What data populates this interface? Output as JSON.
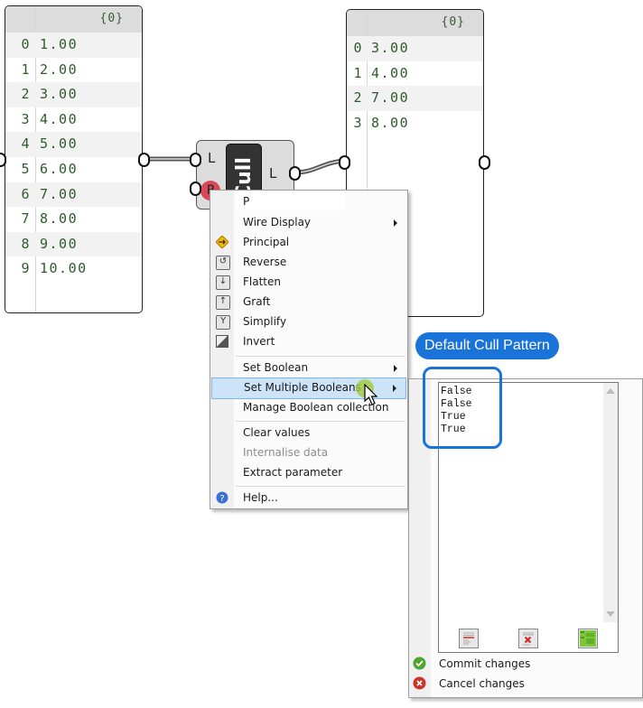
{
  "input_panel": {
    "header": "{0}",
    "rows": [
      {
        "index": "0",
        "value": "1.00"
      },
      {
        "index": "1",
        "value": "2.00"
      },
      {
        "index": "2",
        "value": "3.00"
      },
      {
        "index": "3",
        "value": "4.00"
      },
      {
        "index": "4",
        "value": "5.00"
      },
      {
        "index": "5",
        "value": "6.00"
      },
      {
        "index": "6",
        "value": "7.00"
      },
      {
        "index": "7",
        "value": "8.00"
      },
      {
        "index": "8",
        "value": "9.00"
      },
      {
        "index": "9",
        "value": "10.00"
      }
    ]
  },
  "output_panel": {
    "header": "{0}",
    "rows": [
      {
        "index": "0",
        "value": "3.00"
      },
      {
        "index": "1",
        "value": "4.00"
      },
      {
        "index": "2",
        "value": "7.00"
      },
      {
        "index": "3",
        "value": "8.00"
      }
    ]
  },
  "cull_component": {
    "name": "Cull",
    "input_list_label": "L",
    "input_pattern_label": "P",
    "output_label": "L",
    "pattern_pin_color": "#d9475a"
  },
  "context_menu": {
    "param_name": "P",
    "items": [
      {
        "label": "Wire Display",
        "icon": "",
        "submenu": true
      },
      {
        "label": "Principal",
        "icon": "principal-icon"
      },
      {
        "label": "Reverse",
        "icon": "reverse-icon"
      },
      {
        "label": "Flatten",
        "icon": "flatten-icon"
      },
      {
        "label": "Graft",
        "icon": "graft-icon"
      },
      {
        "label": "Simplify",
        "icon": "simplify-icon"
      },
      {
        "label": "Invert",
        "icon": "invert-icon"
      },
      {
        "label": "Set Boolean",
        "submenu": true
      },
      {
        "label": "Set Multiple Booleans",
        "submenu": true,
        "highlighted": true
      },
      {
        "label": "Manage Boolean collection"
      },
      {
        "label": "Clear values"
      },
      {
        "label": "Internalise data",
        "disabled": true
      },
      {
        "label": "Extract parameter"
      },
      {
        "label": "Help...",
        "icon": "help-icon"
      }
    ]
  },
  "boolean_editor": {
    "lines": [
      "False",
      "False",
      "True",
      "True"
    ],
    "commit_label": "Commit changes",
    "cancel_label": "Cancel changes"
  },
  "annotation": {
    "label": "Default Cull Pattern",
    "color": "#1a73d9"
  }
}
